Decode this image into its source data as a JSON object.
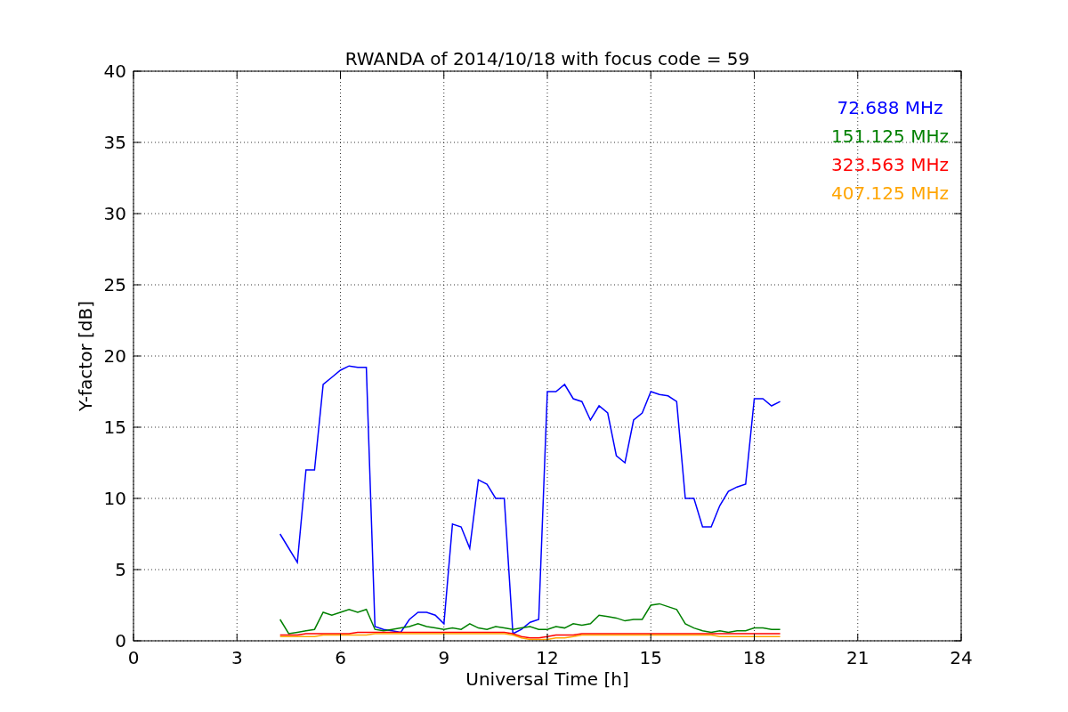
{
  "chart": {
    "chart_data": {
      "type": "line",
      "title": "RWANDA of 2014/10/18 with focus code = 59",
      "xlabel": "Universal Time [h]",
      "ylabel": "Y-factor [dB]",
      "x": [
        4.25,
        4.5,
        4.75,
        5,
        5.25,
        5.5,
        5.75,
        6,
        6.25,
        6.5,
        6.75,
        7,
        7.25,
        7.5,
        7.75,
        8,
        8.25,
        8.5,
        8.75,
        9,
        9.25,
        9.5,
        9.75,
        10,
        10.25,
        10.5,
        10.75,
        11,
        11.25,
        11.5,
        11.75,
        12,
        12.25,
        12.5,
        12.75,
        13,
        13.25,
        13.5,
        13.75,
        14,
        14.25,
        14.5,
        14.75,
        15,
        15.25,
        15.5,
        15.75,
        16,
        16.25,
        16.5,
        16.75,
        17,
        17.25,
        17.5,
        17.75,
        18,
        18.25,
        18.5,
        18.75
      ],
      "series": [
        {
          "name": "72.688 MHz",
          "color": "#0000ff",
          "values": [
            7.5,
            6.5,
            5.5,
            12,
            12,
            18,
            18.5,
            19,
            19.3,
            19.2,
            19.2,
            1,
            0.8,
            0.7,
            0.6,
            1.5,
            2,
            2,
            1.8,
            1.2,
            8.2,
            8,
            6.5,
            11.3,
            11,
            10,
            10,
            0.5,
            0.8,
            1.3,
            1.5,
            17.5,
            17.5,
            18,
            17,
            16.8,
            15.5,
            16.5,
            16,
            13,
            12.5,
            15.5,
            16,
            17.5,
            17.3,
            17.2,
            16.8,
            10,
            10,
            8,
            8,
            9.5,
            10.5,
            10.8,
            11,
            17,
            17,
            16.5,
            16.8
          ]
        },
        {
          "name": "151.125 MHz",
          "color": "#008000",
          "values": [
            1.5,
            0.5,
            0.6,
            0.7,
            0.8,
            2,
            1.8,
            2,
            2.2,
            2,
            2.2,
            0.8,
            0.7,
            0.8,
            0.9,
            1,
            1.2,
            1,
            0.9,
            0.8,
            0.9,
            0.8,
            1.2,
            0.9,
            0.8,
            1,
            0.9,
            0.8,
            0.9,
            1,
            0.8,
            0.8,
            1,
            0.9,
            1.2,
            1.1,
            1.2,
            1.8,
            1.7,
            1.6,
            1.4,
            1.5,
            1.5,
            2.5,
            2.6,
            2.4,
            2.2,
            1.2,
            0.9,
            0.7,
            0.6,
            0.7,
            0.6,
            0.7,
            0.7,
            0.9,
            0.9,
            0.8,
            0.8
          ]
        },
        {
          "name": "323.563 MHz",
          "color": "#ff0000",
          "values": [
            0.4,
            0.4,
            0.4,
            0.5,
            0.5,
            0.5,
            0.5,
            0.5,
            0.5,
            0.6,
            0.6,
            0.6,
            0.6,
            0.6,
            0.6,
            0.6,
            0.6,
            0.6,
            0.6,
            0.6,
            0.6,
            0.6,
            0.6,
            0.6,
            0.6,
            0.6,
            0.6,
            0.5,
            0.3,
            0.2,
            0.2,
            0.3,
            0.4,
            0.4,
            0.4,
            0.5,
            0.5,
            0.5,
            0.5,
            0.5,
            0.5,
            0.5,
            0.5,
            0.5,
            0.5,
            0.5,
            0.5,
            0.5,
            0.5,
            0.5,
            0.5,
            0.5,
            0.5,
            0.5,
            0.5,
            0.5,
            0.5,
            0.5,
            0.5
          ]
        },
        {
          "name": "407.125 MHz",
          "color": "#ffa500",
          "values": [
            0.3,
            0.3,
            0.3,
            0.3,
            0.3,
            0.4,
            0.4,
            0.4,
            0.4,
            0.4,
            0.4,
            0.5,
            0.5,
            0.5,
            0.5,
            0.5,
            0.5,
            0.5,
            0.5,
            0.5,
            0.5,
            0.5,
            0.5,
            0.5,
            0.5,
            0.5,
            0.5,
            0.4,
            0.2,
            0.1,
            0.1,
            0.1,
            0.2,
            0.2,
            0.3,
            0.4,
            0.4,
            0.4,
            0.4,
            0.4,
            0.4,
            0.4,
            0.4,
            0.4,
            0.4,
            0.4,
            0.4,
            0.4,
            0.4,
            0.4,
            0.4,
            0.3,
            0.3,
            0.3,
            0.3,
            0.3,
            0.3,
            0.3,
            0.3
          ]
        }
      ],
      "grid": true,
      "xlim": [
        0,
        24
      ],
      "ylim": [
        0,
        40
      ],
      "xticks": [
        0,
        3,
        6,
        9,
        12,
        15,
        18,
        21,
        24
      ],
      "yticks": [
        0,
        5,
        10,
        15,
        20,
        25,
        30,
        35,
        40
      ]
    }
  }
}
